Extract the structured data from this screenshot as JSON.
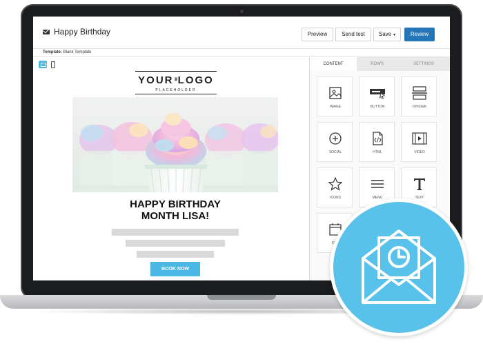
{
  "app": {
    "title": "Happy Birthday",
    "buttons": {
      "preview": "Preview",
      "send_test": "Send test",
      "save": "Save",
      "save_caret": "▾",
      "review": "Review"
    },
    "template_label": "Template:",
    "template_value": "Blank Template"
  },
  "email": {
    "logo_main": "YOUR LOGO",
    "logo_crown": "♛",
    "logo_sub": "PLACEHOLDER",
    "headline_line1": "HAPPY BIRTHDAY",
    "headline_line2": "MONTH LISA!",
    "cta_label": "BOOK NOW"
  },
  "panel": {
    "tabs": [
      "CONTENT",
      "ROWS",
      "SETTINGS"
    ],
    "active_tab": "CONTENT",
    "tiles": [
      {
        "label": "IMAGE",
        "icon": "image-icon"
      },
      {
        "label": "BUTTON",
        "icon": "button-icon"
      },
      {
        "label": "DIVIDER",
        "icon": "divider-icon"
      },
      {
        "label": "SOCIAL",
        "icon": "social-icon"
      },
      {
        "label": "HTML",
        "icon": "html-icon"
      },
      {
        "label": "VIDEO",
        "icon": "video-icon"
      },
      {
        "label": "ICONS",
        "icon": "star-icon"
      },
      {
        "label": "MENU",
        "icon": "menu-icon"
      },
      {
        "label": "TEXT",
        "icon": "text-icon"
      },
      {
        "label": "EVE",
        "icon": "calendar-icon"
      }
    ]
  },
  "colors": {
    "accent": "#4ab7e5",
    "review": "#2476b9",
    "badge": "#58c2ea"
  },
  "badge": {
    "icon": "envelope-clock-icon"
  }
}
